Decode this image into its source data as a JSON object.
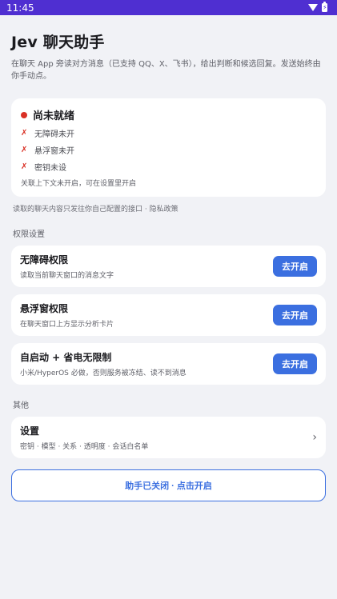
{
  "status_bar": {
    "time": "11:45"
  },
  "header": {
    "title": "Jev 聊天助手",
    "description": "在聊天 App 旁读对方消息（已支持 QQ、X、飞书），给出判断和候选回复。发送始终由你手动点。"
  },
  "status_card": {
    "title": "尚未就绪",
    "items": [
      {
        "label": "无障碍未开"
      },
      {
        "label": "悬浮窗未开"
      },
      {
        "label": "密钥未设"
      }
    ],
    "note": "关联上下文未开启，可在设置里开启"
  },
  "privacy_line": "读取的聊天内容只发往你自己配置的接口 · 隐私政策",
  "permissions": {
    "section_title": "权限设置",
    "items": [
      {
        "title": "无障碍权限",
        "subtitle": "读取当前聊天窗口的消息文字",
        "button": "去开启"
      },
      {
        "title": "悬浮窗权限",
        "subtitle": "在聊天窗口上方显示分析卡片",
        "button": "去开启"
      },
      {
        "title": "自启动 + 省电无限制",
        "subtitle": "小米/HyperOS 必做，否则服务被冻结、读不到消息",
        "button": "去开启"
      }
    ]
  },
  "other": {
    "section_title": "其他",
    "settings": {
      "title": "设置",
      "subtitle": "密钥 · 模型 · 关系 · 透明度 · 会话白名单",
      "chevron": "›"
    }
  },
  "toggle_button": {
    "label": "助手已关闭 · 点击开启"
  },
  "colors": {
    "accent": "#3b6fe0",
    "status_bar": "#4f2fd1",
    "error": "#d93025",
    "background": "#f1f2f6"
  }
}
